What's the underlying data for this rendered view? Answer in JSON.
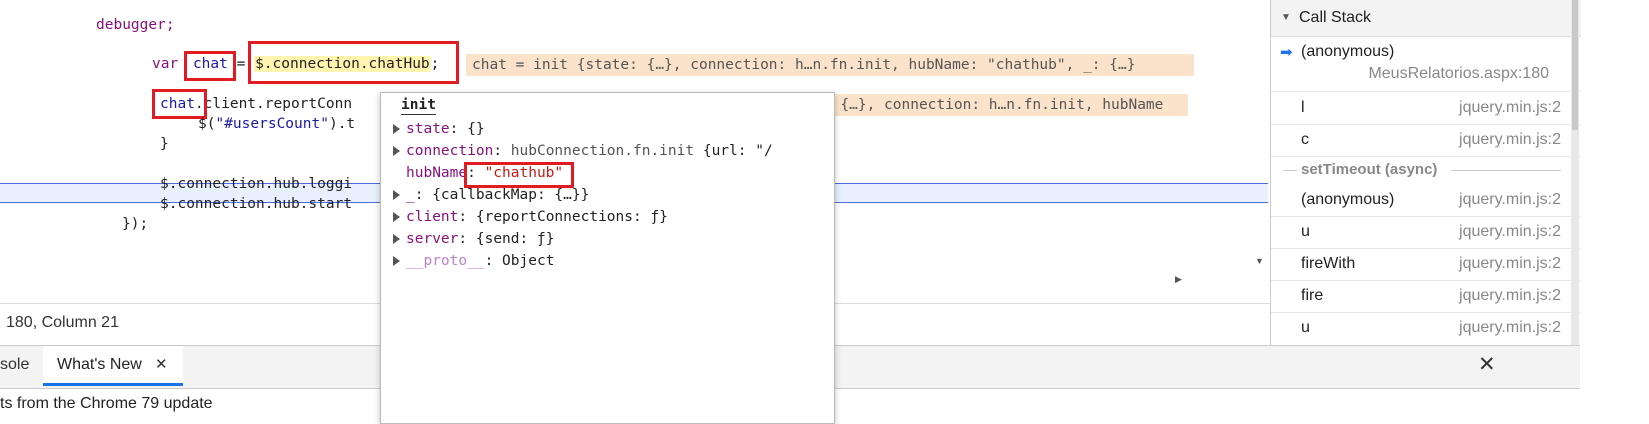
{
  "editor": {
    "lines": {
      "debugger": "debugger;",
      "var_kw": "var",
      "chat_var": "chat",
      "eq": " = ",
      "chat_expr": "$.connection.chatHub",
      "semi": ";",
      "inline1": "chat = init {state: {…}, connection: h…n.fn.init, hubName: \"chathub\", _: {…}",
      "chat2": "chat",
      "line2_rest": ".client.reportConn",
      "inline2": "tate: {…}, connection: h…n.fn.init, hubName",
      "line3_a": "$(",
      "line3_str": "\"#usersCount\"",
      "line3_b": ").t",
      "line4": "}",
      "line5": "$.connection.hub.loggi",
      "line6": "$.connection.hub.start",
      "line7": "});"
    }
  },
  "status": {
    "position": "180, Column 21"
  },
  "drawer": {
    "tabs": [
      {
        "label": "sole"
      },
      {
        "label": "What's New"
      }
    ],
    "close_glyph": "✕",
    "panel_close_glyph": "✕",
    "content": "ts from the Chrome 79 update"
  },
  "popup": {
    "title": "init",
    "rows": [
      {
        "name": "state",
        "value": "{}"
      },
      {
        "name": "connection",
        "value_gray": "hubConnection.fn.init",
        "value": " {url: \"/"
      },
      {
        "name": "hubName",
        "value": "\"chathub\""
      },
      {
        "name": "_",
        "value": "{callbackMap: {…}}"
      },
      {
        "name": "client",
        "value": "{reportConnections: ƒ}"
      },
      {
        "name": "server",
        "value": "{send: ƒ}"
      },
      {
        "name": "__proto__",
        "value": "Object"
      }
    ]
  },
  "callstack": {
    "header": "Call Stack",
    "current": {
      "fn": "(anonymous)",
      "loc": "MeusRelatorios.aspx:180"
    },
    "frames": [
      {
        "fn": "l",
        "loc": "jquery.min.js:2"
      },
      {
        "fn": "c",
        "loc": "jquery.min.js:2"
      }
    ],
    "async_label": "setTimeout (async)",
    "frames2": [
      {
        "fn": "(anonymous)",
        "loc": "jquery.min.js:2"
      },
      {
        "fn": "u",
        "loc": "jquery.min.js:2"
      },
      {
        "fn": "fireWith",
        "loc": "jquery.min.js:2"
      },
      {
        "fn": "fire",
        "loc": "jquery.min.js:2"
      },
      {
        "fn": "u",
        "loc": "jquery.min.js:2"
      }
    ]
  },
  "colors": {
    "highlight": "#e11b22",
    "inline_bg": "#fbe3cb",
    "exec_line": "#e8f0fe"
  }
}
